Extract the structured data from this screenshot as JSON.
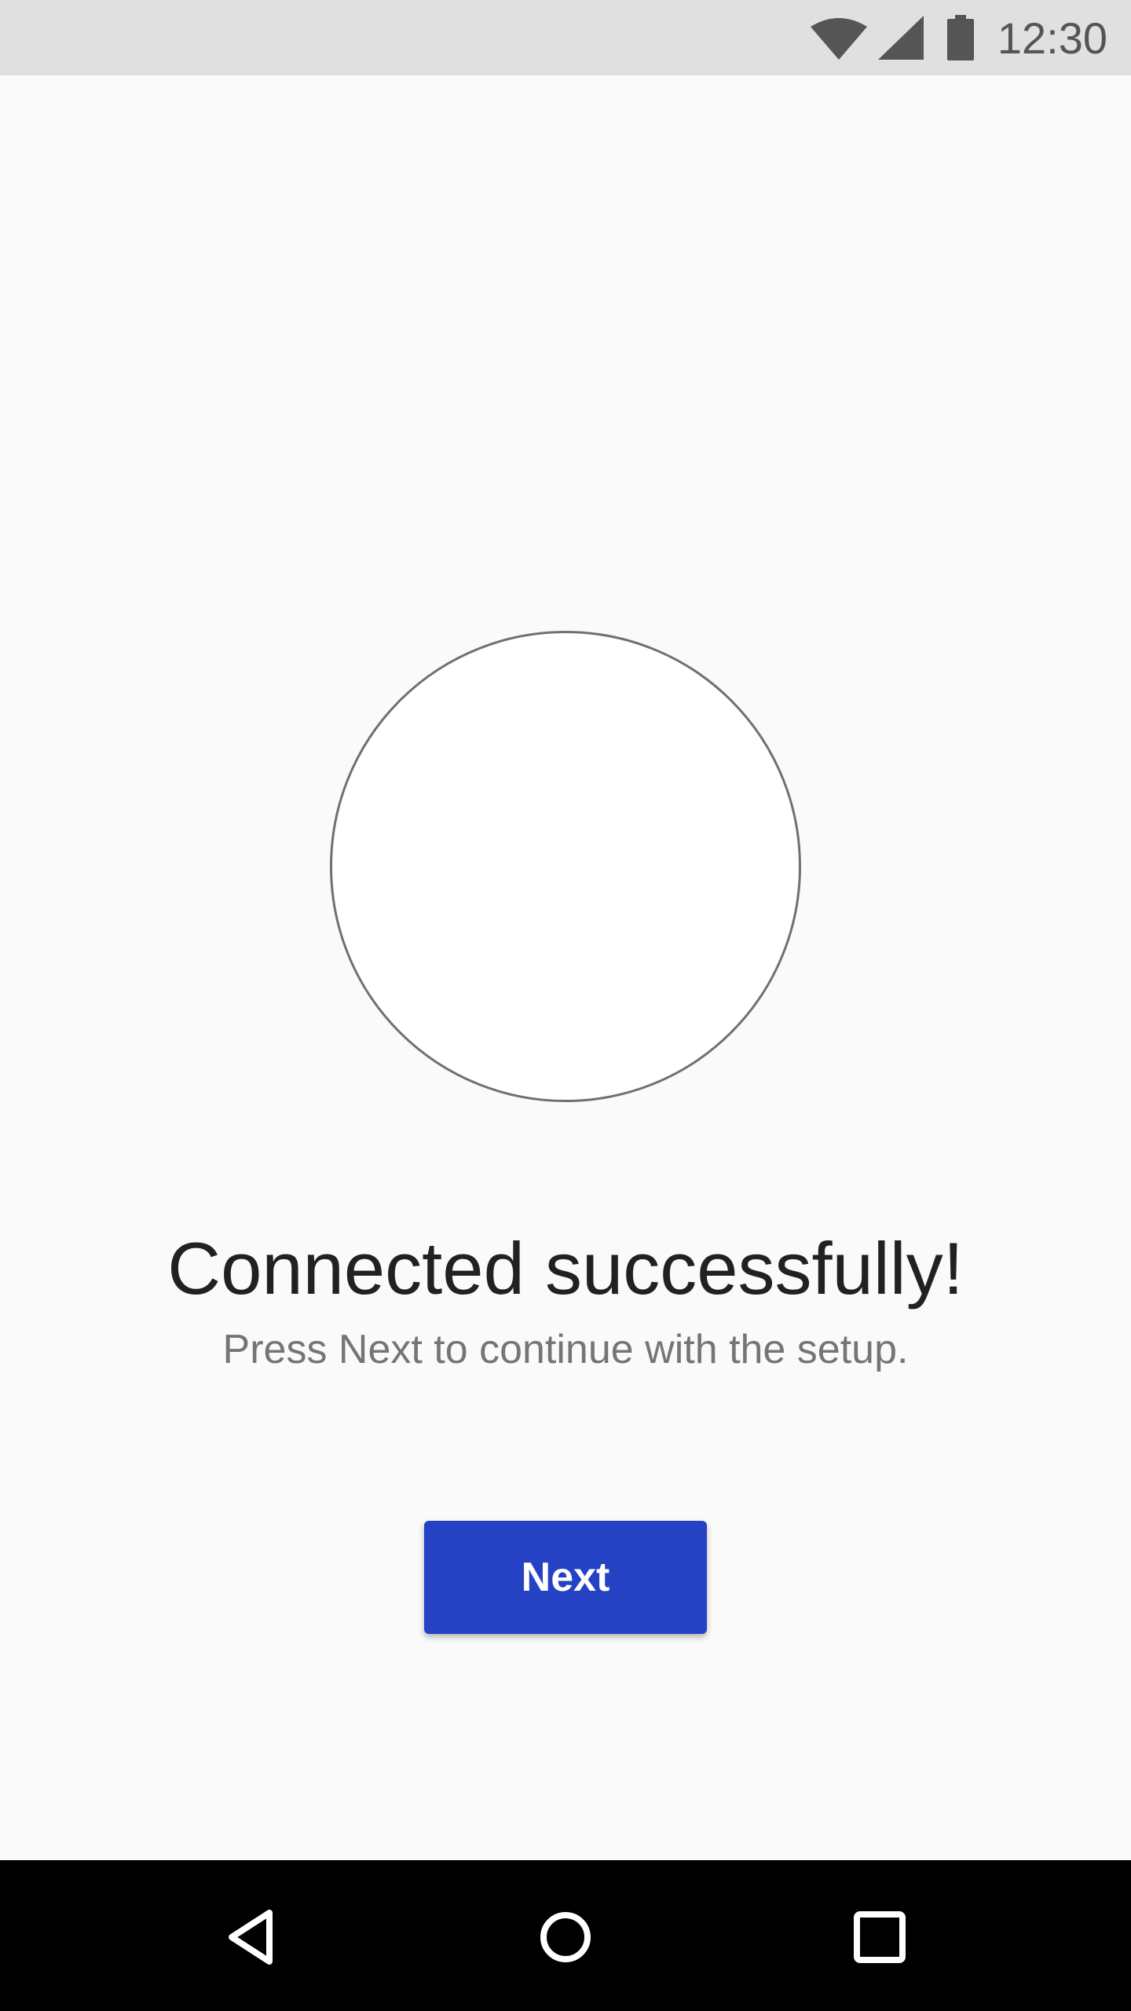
{
  "status_bar": {
    "time": "12:30",
    "icons": [
      "wifi-icon",
      "signal-icon",
      "battery-icon"
    ],
    "background": "#e0e0e0"
  },
  "main": {
    "title": "Connected successfully!",
    "subtitle": "Press Next to continue with the setup.",
    "next_label": "Next",
    "accent_color": "#2541c4"
  },
  "nav_bar": {
    "icons": [
      "back-icon",
      "home-icon",
      "recents-icon"
    ]
  }
}
